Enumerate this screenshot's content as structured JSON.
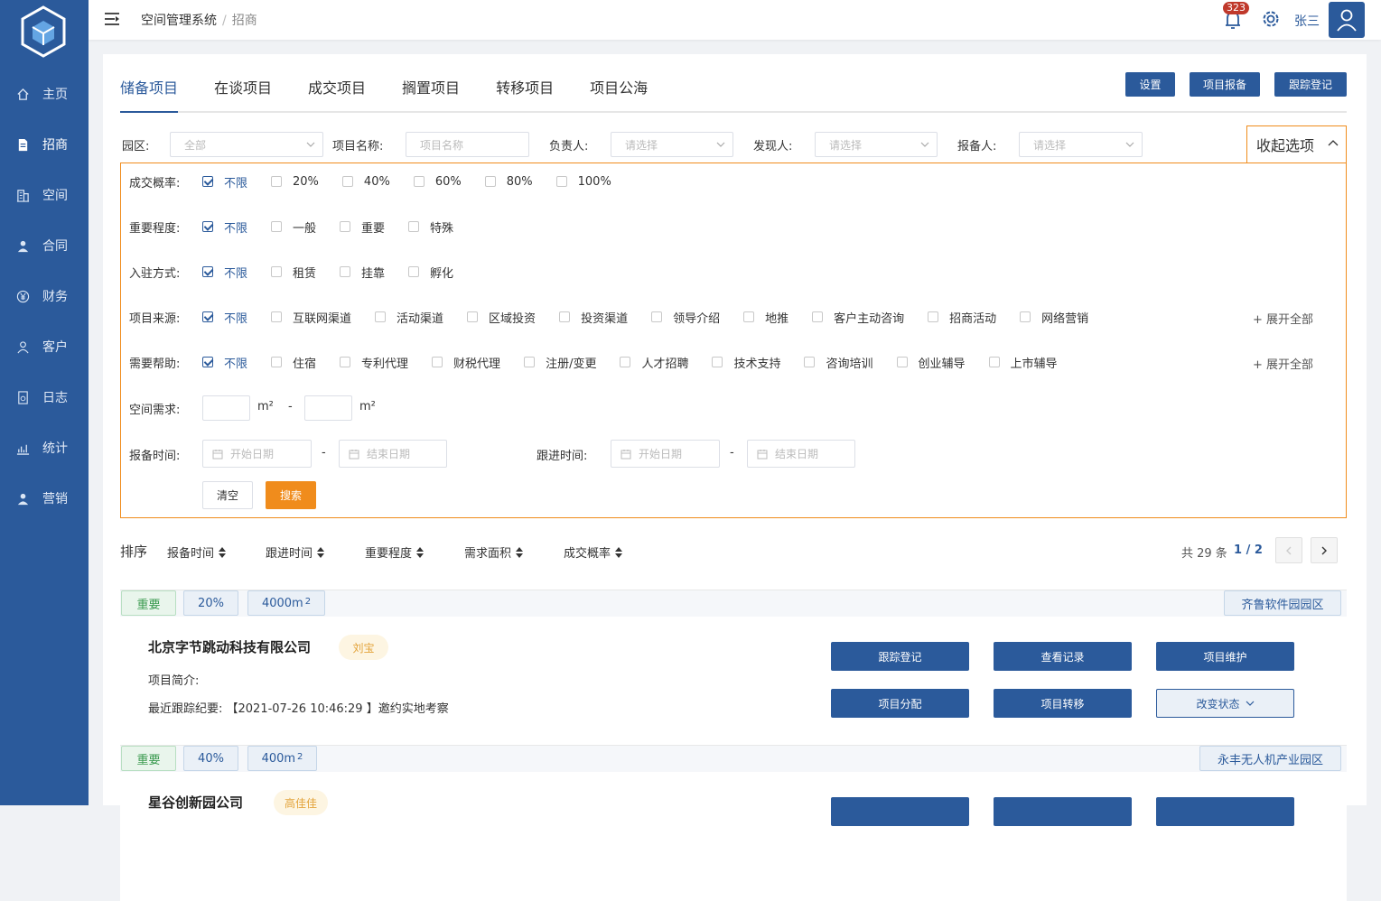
{
  "sidebar": {
    "items": [
      {
        "label": "主页",
        "icon": "home-icon"
      },
      {
        "label": "招商",
        "icon": "document-icon"
      },
      {
        "label": "空间",
        "icon": "building-icon"
      },
      {
        "label": "合同",
        "icon": "person-icon"
      },
      {
        "label": "财务",
        "icon": "yen-icon"
      },
      {
        "label": "客户",
        "icon": "user-outline-icon"
      },
      {
        "label": "日志",
        "icon": "log-icon"
      },
      {
        "label": "统计",
        "icon": "chart-icon"
      },
      {
        "label": "营销",
        "icon": "person-icon"
      }
    ],
    "active_index": 1
  },
  "header": {
    "breadcrumb": [
      "空间管理系统",
      "招商"
    ],
    "notification_count": "323",
    "username": "张三"
  },
  "tabs": [
    "储备项目",
    "在谈项目",
    "成交项目",
    "搁置项目",
    "转移项目",
    "项目公海"
  ],
  "toolbar": {
    "settings": "设置",
    "report": "项目报备",
    "track": "跟踪登记"
  },
  "filters": {
    "park_label": "园区:",
    "park_value": "全部",
    "name_label": "项目名称:",
    "name_placeholder": "项目名称",
    "owner_label": "负责人:",
    "owner_placeholder": "请选择",
    "finder_label": "发现人:",
    "finder_placeholder": "请选择",
    "reporter_label": "报备人:",
    "reporter_placeholder": "请选择",
    "collapse_label": "收起选项"
  },
  "options": {
    "probability": {
      "label": "成交概率:",
      "items": [
        "不限",
        "20%",
        "40%",
        "60%",
        "80%",
        "100%"
      ]
    },
    "importance": {
      "label": "重要程度:",
      "items": [
        "不限",
        "一般",
        "重要",
        "特殊"
      ]
    },
    "entry": {
      "label": "入驻方式:",
      "items": [
        "不限",
        "租赁",
        "挂靠",
        "孵化"
      ]
    },
    "source": {
      "label": "项目来源:",
      "items": [
        "不限",
        "互联网渠道",
        "活动渠道",
        "区域投资",
        "投资渠道",
        "领导介绍",
        "地推",
        "客户主动咨询",
        "招商活动",
        "网络营销"
      ]
    },
    "help": {
      "label": "需要帮助:",
      "items": [
        "不限",
        "住宿",
        "专利代理",
        "财税代理",
        "注册/变更",
        "人才招聘",
        "技术支持",
        "咨询培训",
        "创业辅导",
        "上市辅导"
      ]
    },
    "expand_all": "+ 展开全部",
    "space_label": "空间需求:",
    "unit": "m²",
    "dash": "-",
    "report_time_label": "报备时间:",
    "follow_time_label": "跟进时间:",
    "start_date": "开始日期",
    "end_date": "结束日期",
    "clear": "清空",
    "search": "搜索"
  },
  "sort": {
    "title": "排序",
    "items": [
      "报备时间",
      "跟进时间",
      "重要程度",
      "需求面积",
      "成交概率"
    ],
    "total": "共 29 条",
    "page": "1 / 2"
  },
  "cards": [
    {
      "importance": "重要",
      "probability": "20%",
      "area": "4000m",
      "area_sup": "2",
      "park": "齐鲁软件园园区",
      "company": "北京字节跳动科技有限公司",
      "person": "刘宝",
      "intro": "项目简介:",
      "last_track": "最近跟踪纪要:  【2021-07-26 10:46:29 】邀约实地考察",
      "actions": [
        "跟踪登记",
        "查看记录",
        "项目维护",
        "项目分配",
        "项目转移",
        "改变状态"
      ]
    },
    {
      "importance": "重要",
      "probability": "40%",
      "area": "400m",
      "area_sup": "2",
      "park": "永丰无人机产业园区",
      "company": "星谷创新园公司",
      "person": "高佳佳"
    }
  ]
}
